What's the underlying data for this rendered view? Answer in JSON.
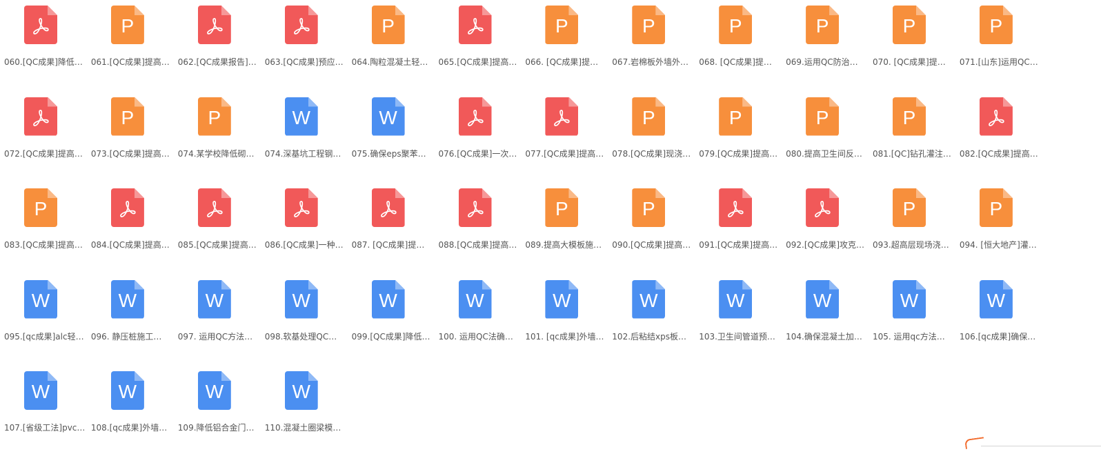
{
  "colors": {
    "pdf": "#f15959",
    "ppt": "#f78f3c",
    "doc": "#4b8ff1",
    "text": "#555555",
    "background": "#ffffff"
  },
  "icons": {
    "pdf": "pdf-file-icon",
    "ppt": "ppt-file-icon",
    "doc": "word-file-icon"
  },
  "files": [
    {
      "name": "060.[QC成果]降低…",
      "type": "pdf"
    },
    {
      "name": "061.[QC成果]提高…",
      "type": "ppt"
    },
    {
      "name": "062.[QC成果报告]…",
      "type": "pdf"
    },
    {
      "name": "063.[QC成果]预应…",
      "type": "pdf"
    },
    {
      "name": "064.陶粒混凝土轻…",
      "type": "ppt"
    },
    {
      "name": "065.[QC成果]提高…",
      "type": "pdf"
    },
    {
      "name": "066. [QC成果]提…",
      "type": "ppt"
    },
    {
      "name": "067.岩棉板外墙外…",
      "type": "ppt"
    },
    {
      "name": "068. [QC成果]提…",
      "type": "ppt"
    },
    {
      "name": "069.运用QC防治…",
      "type": "ppt"
    },
    {
      "name": "070. [QC成果]提…",
      "type": "ppt"
    },
    {
      "name": "071.[山东]运用QC…",
      "type": "ppt"
    },
    {
      "name": "072.[QC成果]提高…",
      "type": "pdf"
    },
    {
      "name": "073.[QC成果]提高…",
      "type": "ppt"
    },
    {
      "name": "074.某学校降低砌…",
      "type": "ppt"
    },
    {
      "name": "074.深基坑工程钢…",
      "type": "doc"
    },
    {
      "name": "075.确保eps聚苯…",
      "type": "doc"
    },
    {
      "name": "076.[QC成果]一次…",
      "type": "pdf"
    },
    {
      "name": "077.[QC成果]提高…",
      "type": "pdf"
    },
    {
      "name": "078.[QC成果]现浇…",
      "type": "ppt"
    },
    {
      "name": "079.[QC成果]提高…",
      "type": "ppt"
    },
    {
      "name": "080.提高卫生间反…",
      "type": "ppt"
    },
    {
      "name": "081.[QC]钻孔灌注…",
      "type": "ppt"
    },
    {
      "name": "082.[QC成果]提高…",
      "type": "pdf"
    },
    {
      "name": "083.[QC成果]提高…",
      "type": "ppt"
    },
    {
      "name": "084.[QC成果]提高…",
      "type": "pdf"
    },
    {
      "name": "085.[QC成果]提高…",
      "type": "pdf"
    },
    {
      "name": "086.[QC成果]一种…",
      "type": "pdf"
    },
    {
      "name": "087. [QC成果]提…",
      "type": "pdf"
    },
    {
      "name": "088.[QC成果]提高…",
      "type": "pdf"
    },
    {
      "name": "089.提高大模板施…",
      "type": "ppt"
    },
    {
      "name": "090.[QC成果]提高…",
      "type": "ppt"
    },
    {
      "name": "091.[QC成果]提高…",
      "type": "pdf"
    },
    {
      "name": "092.[QC成果]攻克…",
      "type": "pdf"
    },
    {
      "name": "093.超高层现场浇…",
      "type": "ppt"
    },
    {
      "name": "094. [恒大地产]灌…",
      "type": "ppt"
    },
    {
      "name": "095.[qc成果]alc轻…",
      "type": "doc"
    },
    {
      "name": "096. 静压桩施工…",
      "type": "doc"
    },
    {
      "name": "097. 运用QC方法…",
      "type": "doc"
    },
    {
      "name": "098.软基处理QC…",
      "type": "doc"
    },
    {
      "name": "099.[QC成果]降低…",
      "type": "doc"
    },
    {
      "name": "100. 运用QC法确…",
      "type": "doc"
    },
    {
      "name": "101. [qc成果]外墙…",
      "type": "doc"
    },
    {
      "name": "102.后粘结xps板…",
      "type": "doc"
    },
    {
      "name": "103.卫生间管道预…",
      "type": "doc"
    },
    {
      "name": "104.确保混凝土加…",
      "type": "doc"
    },
    {
      "name": "105. 运用qc方法…",
      "type": "doc"
    },
    {
      "name": "106.[qc成果]确保…",
      "type": "doc"
    },
    {
      "name": "107.[省级工法]pvc…",
      "type": "doc"
    },
    {
      "name": "108.[qc成果]外墙…",
      "type": "doc"
    },
    {
      "name": "109.降低铝合金门…",
      "type": "doc"
    },
    {
      "name": "110.混凝土圈梁模…",
      "type": "doc"
    }
  ]
}
